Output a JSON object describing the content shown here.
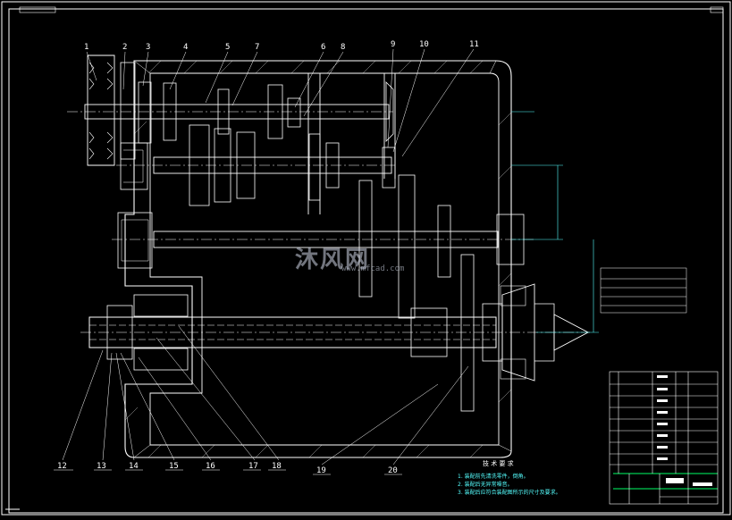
{
  "part_numbers": [
    "1",
    "2",
    "3",
    "4",
    "5",
    "7",
    "6",
    "8",
    "9",
    "10",
    "11",
    "12",
    "13",
    "14",
    "15",
    "16",
    "17",
    "18",
    "19",
    "20"
  ],
  "technical_requirements": {
    "title": "技 术 要 求",
    "lines": [
      "1. 装配前先清洗零件，倒角。",
      "2. 装配后无异常噪音。",
      "3. 装配后应符合装配图所示的尺寸及要求。"
    ]
  },
  "watermark": {
    "text": "沐风网",
    "url": "www.mfcad.com"
  },
  "colors": {
    "background": "#000000",
    "lines": "#ffffff",
    "centerlines": "#ffffff",
    "text_cyan": "#55ffff",
    "green": "#00ff66"
  }
}
